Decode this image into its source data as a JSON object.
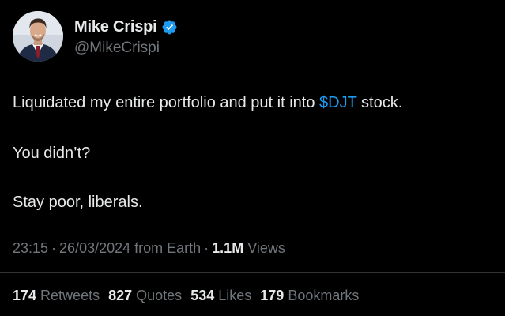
{
  "author": {
    "display_name": "Mike Crispi",
    "handle": "@MikeCrispi",
    "verified": true,
    "avatar_icon": "profile-photo"
  },
  "tweet": {
    "line1_before": "Liquidated my entire portfolio and put it into ",
    "cashtag": "$DJT",
    "line1_after": " stock.",
    "line2": "You didn’t?",
    "line3": "Stay poor, liberals."
  },
  "meta": {
    "time": "23:15",
    "date": "26/03/2024",
    "source": "from Earth",
    "views_count": "1.1M",
    "views_label": "Views",
    "separator": "·"
  },
  "stats": [
    {
      "count": "174",
      "label": "Retweets"
    },
    {
      "count": "827",
      "label": "Quotes"
    },
    {
      "count": "534",
      "label": "Likes"
    },
    {
      "count": "179",
      "label": "Bookmarks"
    }
  ],
  "colors": {
    "background": "#000000",
    "text": "#e7e9ea",
    "secondary": "#71767b",
    "accent": "#1d9bf0",
    "divider": "#2f3336"
  }
}
